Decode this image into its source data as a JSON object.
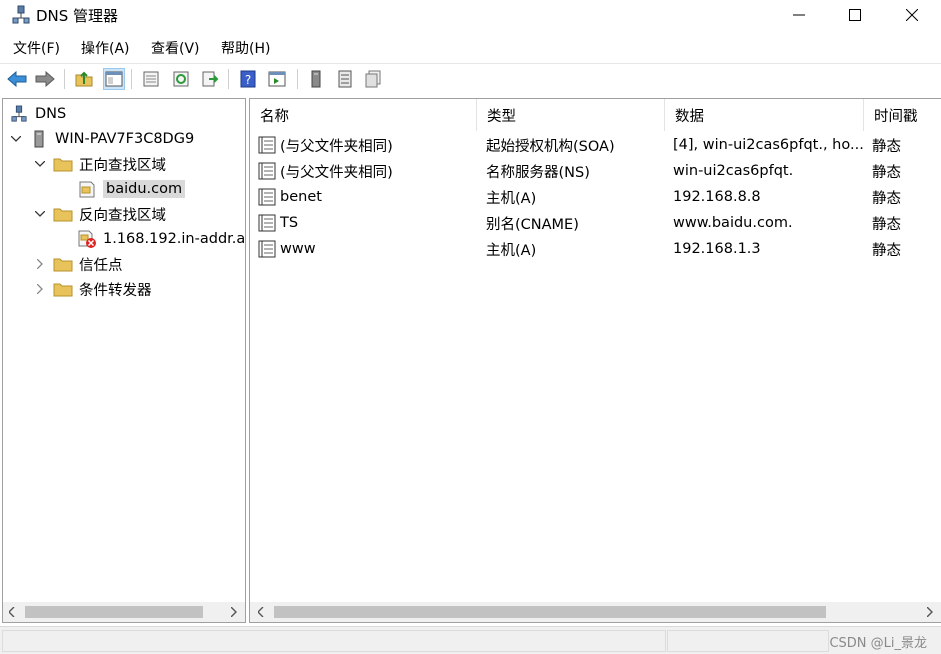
{
  "window": {
    "title": "DNS 管理器"
  },
  "menu": [
    {
      "label": "文件(F)"
    },
    {
      "label": "操作(A)"
    },
    {
      "label": "查看(V)"
    },
    {
      "label": "帮助(H)"
    }
  ],
  "tree": {
    "root": "DNS",
    "server": "WIN-PAV7F3C8DG9",
    "forward_zones": "正向查找区域",
    "forward_zone_item": "baidu.com",
    "reverse_zones": "反向查找区域",
    "reverse_zone_item": "1.168.192.in-addr.a",
    "trust_points": "信任点",
    "conditional_forwarders": "条件转发器"
  },
  "list": {
    "columns": [
      "名称",
      "类型",
      "数据",
      "时间戳"
    ],
    "rows": [
      {
        "name": "(与父文件夹相同)",
        "type": "起始授权机构(SOA)",
        "data": "[4], win-ui2cas6pfqt., ho...",
        "timestamp": "静态"
      },
      {
        "name": "(与父文件夹相同)",
        "type": "名称服务器(NS)",
        "data": "win-ui2cas6pfqt.",
        "timestamp": "静态"
      },
      {
        "name": "benet",
        "type": "主机(A)",
        "data": "192.168.8.8",
        "timestamp": "静态"
      },
      {
        "name": "TS",
        "type": "别名(CNAME)",
        "data": "www.baidu.com.",
        "timestamp": "静态"
      },
      {
        "name": "www",
        "type": "主机(A)",
        "data": "192.168.1.3",
        "timestamp": "静态"
      }
    ]
  },
  "status": {
    "watermark": "CSDN @Li_景龙"
  },
  "colors": {
    "accent": "#1e78c8",
    "folder": "#e8c25a",
    "selected": "#d9d9d9"
  }
}
